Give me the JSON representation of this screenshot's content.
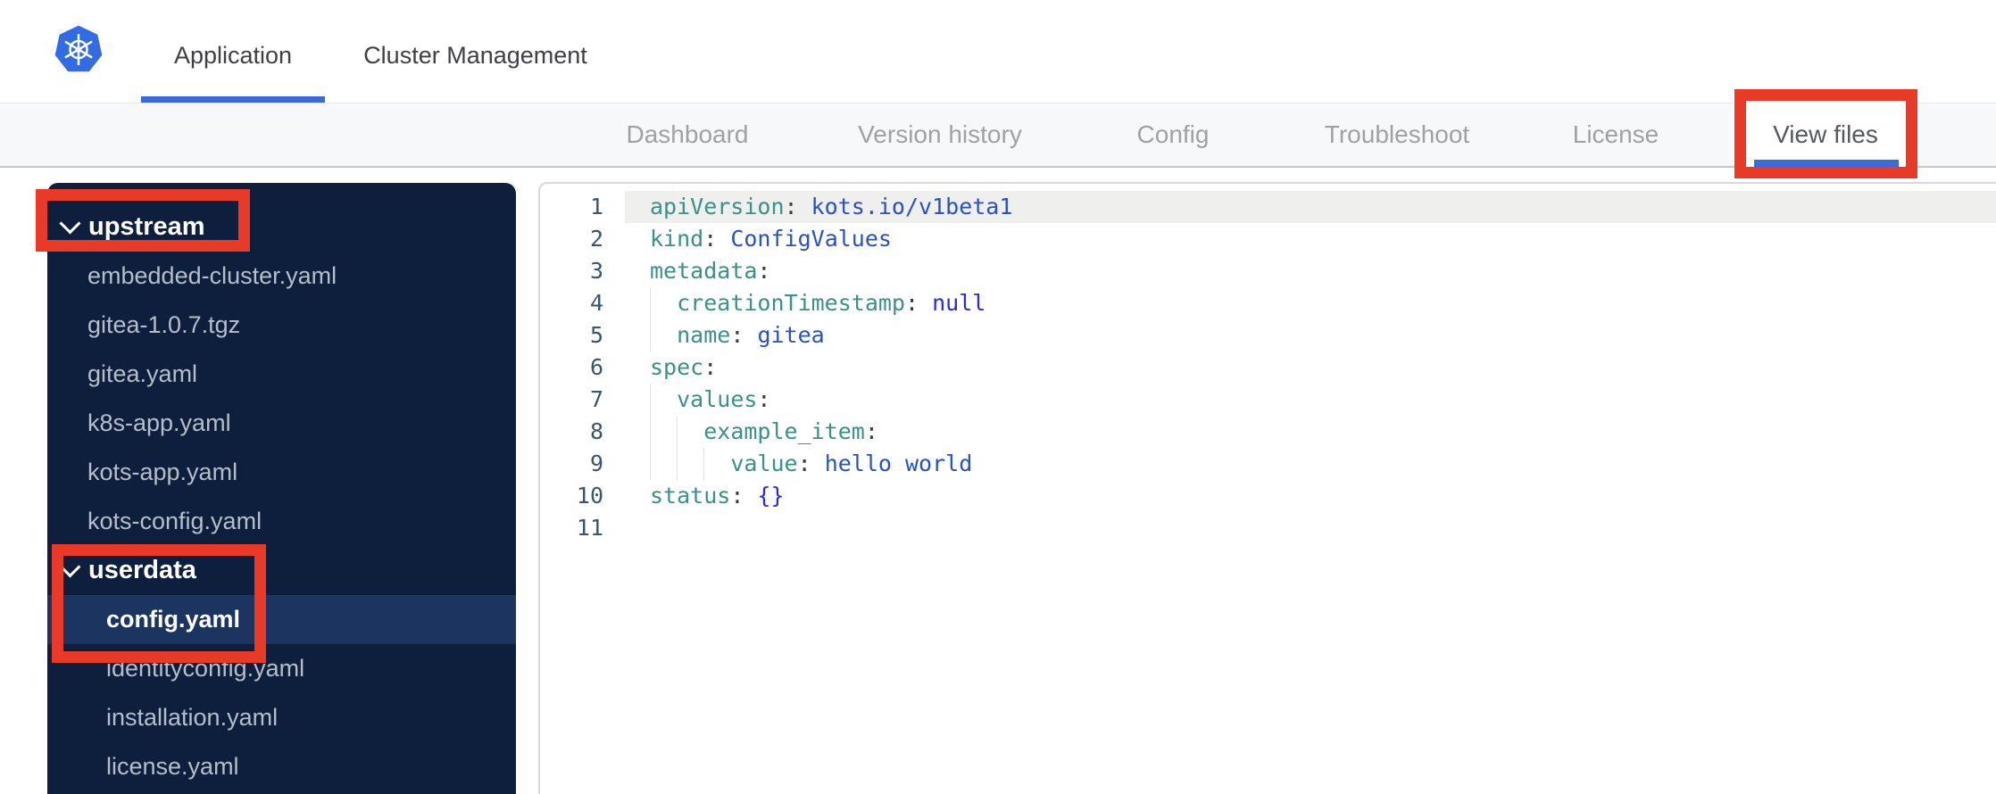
{
  "top_nav": {
    "tabs": [
      {
        "label": "Application",
        "active": true
      },
      {
        "label": "Cluster Management",
        "active": false
      }
    ]
  },
  "sub_nav": {
    "tabs": [
      {
        "label": "Dashboard",
        "active": false
      },
      {
        "label": "Version history",
        "active": false
      },
      {
        "label": "Config",
        "active": false
      },
      {
        "label": "Troubleshoot",
        "active": false
      },
      {
        "label": "License",
        "active": false
      },
      {
        "label": "View files",
        "active": true
      }
    ]
  },
  "file_tree": {
    "items": [
      {
        "label": "upstream",
        "type": "folder",
        "expanded": true,
        "level": 0,
        "selected": false
      },
      {
        "label": "embedded-cluster.yaml",
        "type": "file",
        "level": 1,
        "selected": false
      },
      {
        "label": "gitea-1.0.7.tgz",
        "type": "file",
        "level": 1,
        "selected": false
      },
      {
        "label": "gitea.yaml",
        "type": "file",
        "level": 1,
        "selected": false
      },
      {
        "label": "k8s-app.yaml",
        "type": "file",
        "level": 1,
        "selected": false
      },
      {
        "label": "kots-app.yaml",
        "type": "file",
        "level": 1,
        "selected": false
      },
      {
        "label": "kots-config.yaml",
        "type": "file",
        "level": 1,
        "selected": false
      },
      {
        "label": "userdata",
        "type": "folder",
        "expanded": true,
        "level": 0,
        "selected": false
      },
      {
        "label": "config.yaml",
        "type": "file",
        "level": 2,
        "selected": true
      },
      {
        "label": "identityconfig.yaml",
        "type": "file",
        "level": 2,
        "selected": false
      },
      {
        "label": "installation.yaml",
        "type": "file",
        "level": 2,
        "selected": false
      },
      {
        "label": "license.yaml",
        "type": "file",
        "level": 2,
        "selected": false
      }
    ]
  },
  "editor": {
    "lines": [
      {
        "n": 1,
        "indent": 0,
        "active": true,
        "tokens": [
          [
            "key",
            "apiVersion"
          ],
          [
            "punc",
            ":"
          ],
          [
            "str",
            " kots.io/v1beta1"
          ]
        ]
      },
      {
        "n": 2,
        "indent": 0,
        "active": false,
        "tokens": [
          [
            "key",
            "kind"
          ],
          [
            "punc",
            ":"
          ],
          [
            "str",
            " ConfigValues"
          ]
        ]
      },
      {
        "n": 3,
        "indent": 0,
        "active": false,
        "tokens": [
          [
            "key",
            "metadata"
          ],
          [
            "punc",
            ":"
          ]
        ]
      },
      {
        "n": 4,
        "indent": 2,
        "active": false,
        "tokens": [
          [
            "key",
            "creationTimestamp"
          ],
          [
            "punc",
            ":"
          ],
          [
            "const",
            " null"
          ]
        ]
      },
      {
        "n": 5,
        "indent": 2,
        "active": false,
        "tokens": [
          [
            "key",
            "name"
          ],
          [
            "punc",
            ":"
          ],
          [
            "str",
            " gitea"
          ]
        ]
      },
      {
        "n": 6,
        "indent": 0,
        "active": false,
        "tokens": [
          [
            "key",
            "spec"
          ],
          [
            "punc",
            ":"
          ]
        ]
      },
      {
        "n": 7,
        "indent": 2,
        "active": false,
        "tokens": [
          [
            "key",
            "values"
          ],
          [
            "punc",
            ":"
          ]
        ]
      },
      {
        "n": 8,
        "indent": 4,
        "active": false,
        "tokens": [
          [
            "key",
            "example_item"
          ],
          [
            "punc",
            ":"
          ]
        ]
      },
      {
        "n": 9,
        "indent": 6,
        "active": false,
        "tokens": [
          [
            "key",
            "value"
          ],
          [
            "punc",
            ":"
          ],
          [
            "str",
            " hello world"
          ]
        ]
      },
      {
        "n": 10,
        "indent": 0,
        "active": false,
        "tokens": [
          [
            "key",
            "status"
          ],
          [
            "punc",
            ":"
          ],
          [
            "const",
            " {}"
          ]
        ]
      },
      {
        "n": 11,
        "indent": 0,
        "active": false,
        "tokens": []
      }
    ]
  },
  "annotations": {
    "color": "#E93A27",
    "boxes": [
      "upstream-folder",
      "userdata-config-selection",
      "view-files-tab"
    ]
  },
  "colors": {
    "brand_blue": "#326CE5",
    "accent_underline": "#3B6BDB",
    "annotation_red": "#E93A27",
    "sidebar_bg": "#0E1F3E",
    "sidebar_selected_bg": "#1C3560",
    "code_key": "#38918A",
    "code_string": "#2852C4",
    "code_constant": "#2B2BDE"
  }
}
